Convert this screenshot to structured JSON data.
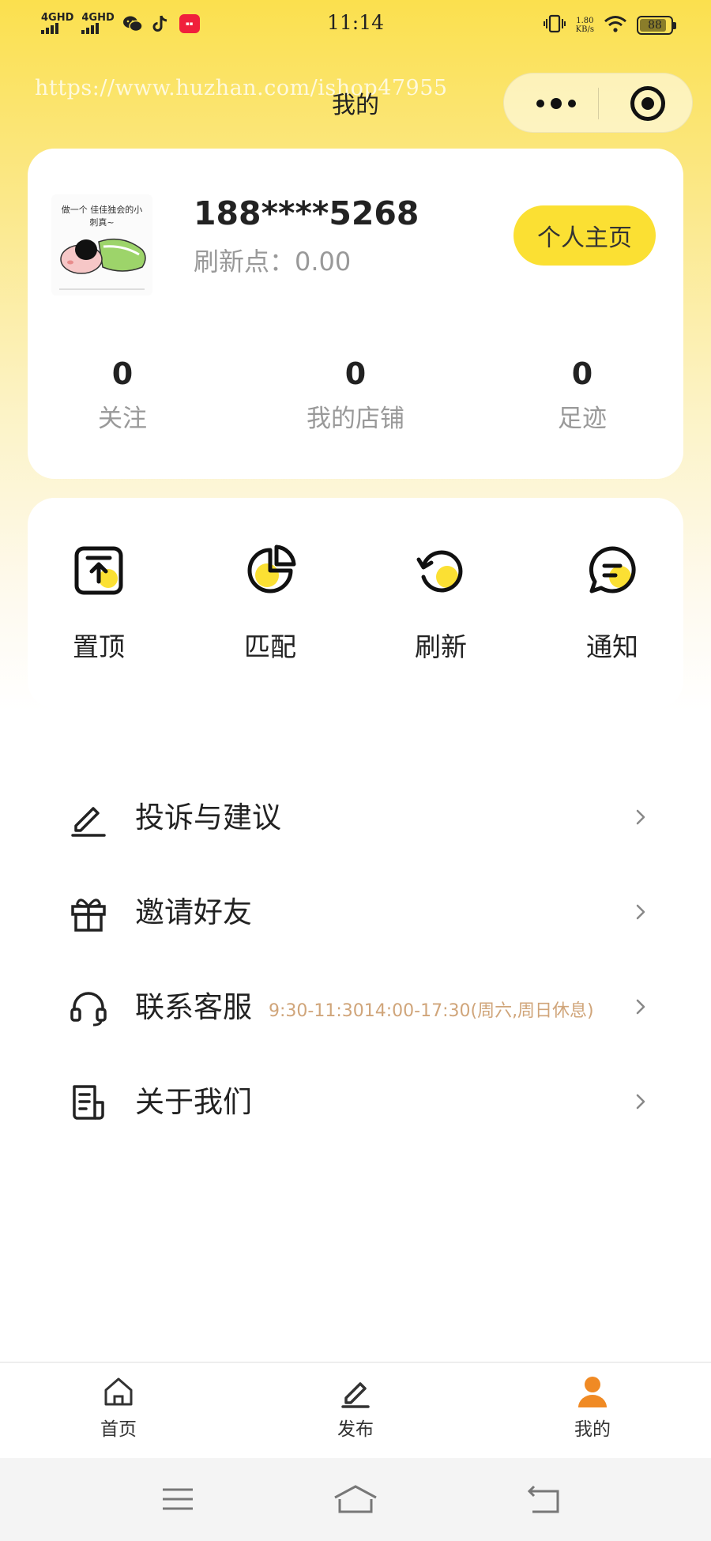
{
  "status_bar": {
    "signal_1": "4GHD",
    "signal_2": "4GHD",
    "time": "11:14",
    "speed_value": "1.80",
    "speed_unit": "KB/s",
    "battery": "88",
    "battery_level": 0.88
  },
  "header": {
    "title": "我的",
    "watermark": "https://www.huzhan.com/ishop47955"
  },
  "profile": {
    "avatar_caption": "做一个 佳佳独会的小刺真~",
    "phone": "188****5268",
    "points": "刷新点：0.00",
    "homepage_button": "个人主页",
    "stats": [
      {
        "value": "0",
        "label": "关注"
      },
      {
        "value": "0",
        "label": "我的店铺"
      },
      {
        "value": "0",
        "label": "足迹"
      }
    ]
  },
  "actions": [
    {
      "label": "置顶",
      "icon": "pin-top-icon"
    },
    {
      "label": "匹配",
      "icon": "pie-chart-icon"
    },
    {
      "label": "刷新",
      "icon": "refresh-icon"
    },
    {
      "label": "通知",
      "icon": "message-icon"
    }
  ],
  "menu": [
    {
      "label": "投诉与建议",
      "icon": "edit-icon",
      "note": ""
    },
    {
      "label": "邀请好友",
      "icon": "gift-icon",
      "note": ""
    },
    {
      "label": "联系客服",
      "icon": "headset-icon",
      "note": "9:30-11:3014:00-17:30(周六,周日休息)"
    },
    {
      "label": "关于我们",
      "icon": "document-icon",
      "note": ""
    }
  ],
  "tabbar": [
    {
      "label": "首页",
      "icon": "home-icon"
    },
    {
      "label": "发布",
      "icon": "publish-icon"
    },
    {
      "label": "我的",
      "icon": "user-icon",
      "active": true
    }
  ],
  "colors": {
    "accent": "#fbe033",
    "active_tab": "#f08a24",
    "note": "#d0a57a"
  }
}
